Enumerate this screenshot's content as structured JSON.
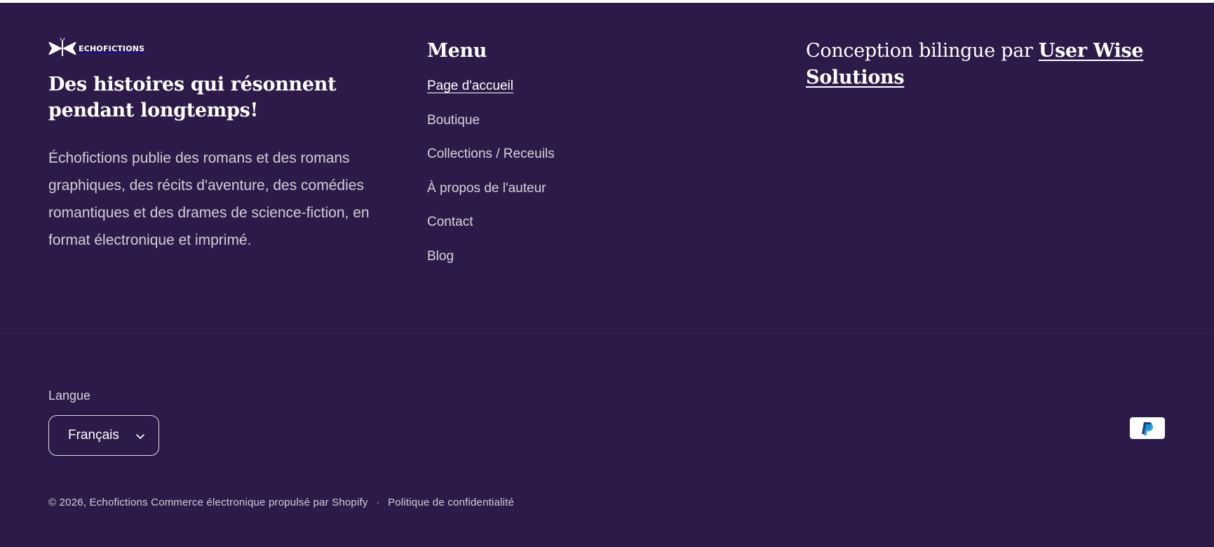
{
  "brand": {
    "logo_text": "Echofictions",
    "tagline": "Des histoires qui résonnent pendant longtemps!",
    "description": "Échofictions publie des romans et des romans graphiques, des récits d'aventure, des comédies romantiques et des drames de science-fiction, en format électronique et imprimé."
  },
  "menu": {
    "heading": "Menu",
    "items": [
      {
        "label": "Page d'accueil",
        "active": true
      },
      {
        "label": "Boutique",
        "active": false
      },
      {
        "label": "Collections / Receuils",
        "active": false
      },
      {
        "label": "À propos de l'auteur",
        "active": false
      },
      {
        "label": "Contact",
        "active": false
      },
      {
        "label": "Blog",
        "active": false
      }
    ]
  },
  "credit": {
    "prefix": "Conception bilingue par",
    "link_label": "User Wise Solutions"
  },
  "language": {
    "label": "Langue",
    "selected": "Français"
  },
  "payment": {
    "icons": [
      "paypal-icon"
    ]
  },
  "legal": {
    "copyright": "© 2026, Echofictions Commerce électronique propulsé par Shopify",
    "separator": "·",
    "privacy_label": "Politique de confidentialité"
  },
  "colors": {
    "background": "#2d1a48",
    "text": "#ffffff",
    "paypal_blue": "#253b80",
    "paypal_light_blue": "#179bd7"
  }
}
